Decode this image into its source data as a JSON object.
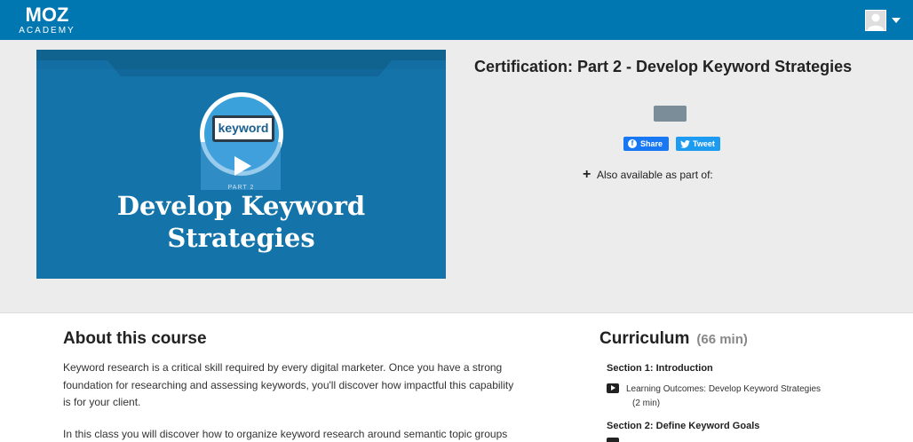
{
  "header": {
    "logo_main": "MOZ",
    "logo_sub": "ACADEMY",
    "user_menu_icon": "avatar-placeholder",
    "colors": {
      "bar": "#0077b0"
    }
  },
  "hero": {
    "video": {
      "badge_text": "keyword",
      "part_label": "PART 2",
      "title_line1": "Develop Keyword",
      "title_line2": "Strategies",
      "play_icon": "play-icon"
    },
    "course_title": "Certification: Part 2 - Develop Keyword Strategies",
    "share": {
      "facebook_label": "Share",
      "twitter_label": "Tweet"
    },
    "also_available": "Also available as part of:"
  },
  "about": {
    "title": "About this course",
    "paragraph1": "Keyword research is a critical skill required by every digital marketer. Once you have a strong foundation for researching and assessing keywords, you'll discover how impactful this capability is for your client.",
    "paragraph2": "In this class you will discover how to organize keyword research around semantic topic groups"
  },
  "curriculum": {
    "title": "Curriculum",
    "duration": "(66 min)",
    "sections": [
      {
        "label": "Section 1: Introduction",
        "lessons": [
          {
            "title": "Learning Outcomes: Develop Keyword Strategies",
            "duration": "(2 min)",
            "icon": "video-icon"
          }
        ]
      },
      {
        "label": "Section 2: Define Keyword Goals",
        "lessons": []
      }
    ]
  }
}
